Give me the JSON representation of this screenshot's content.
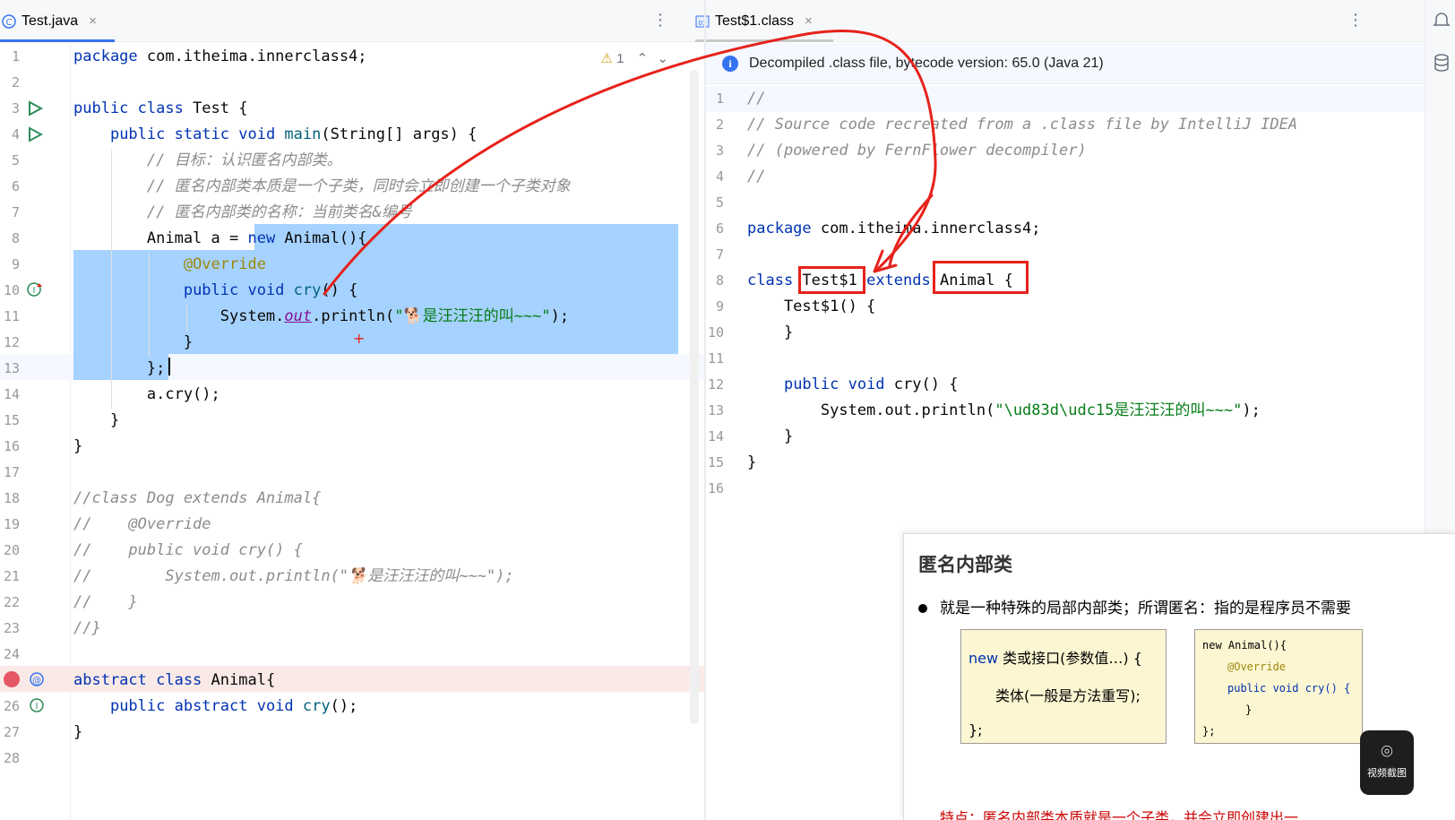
{
  "tabs": {
    "left": {
      "label": "Test.java",
      "close": "×",
      "icon": "java-class-icon"
    },
    "right": {
      "label": "Test$1.class",
      "close": "×",
      "icon": "class-file-icon"
    },
    "menu": "⋮"
  },
  "left_editor": {
    "inspection": {
      "warning": "⚠",
      "count": "1",
      "up": "⌃",
      "down": "⌄"
    },
    "lines": [
      {
        "n": "1",
        "segs": [
          [
            "kw",
            "package "
          ],
          [
            "",
            "com.itheima.innerclass4;"
          ]
        ]
      },
      {
        "n": "2",
        "segs": []
      },
      {
        "n": "3",
        "segs": [
          [
            "kw",
            "public class "
          ],
          [
            "",
            "Test {"
          ]
        ]
      },
      {
        "n": "4",
        "segs": [
          [
            "",
            "    "
          ],
          [
            "kw",
            "public static void "
          ],
          [
            "fn",
            "main"
          ],
          [
            "",
            "(String[] args) {"
          ]
        ]
      },
      {
        "n": "5",
        "segs": [
          [
            "",
            "        "
          ],
          [
            "cm",
            "// 目标：认识匿名内部类。"
          ]
        ]
      },
      {
        "n": "6",
        "segs": [
          [
            "",
            "        "
          ],
          [
            "cm",
            "// 匿名内部类本质是一个子类，同时会立即创建一个子类对象"
          ]
        ]
      },
      {
        "n": "7",
        "segs": [
          [
            "",
            "        "
          ],
          [
            "cm",
            "// 匿名内部类的名称：当前类名&编号"
          ]
        ]
      },
      {
        "n": "8",
        "segs": [
          [
            "",
            "        Animal a = "
          ],
          [
            "kw",
            "new "
          ],
          [
            "",
            "Animal(){"
          ]
        ]
      },
      {
        "n": "9",
        "segs": [
          [
            "",
            "            "
          ],
          [
            "an",
            "@Override"
          ]
        ]
      },
      {
        "n": "10",
        "segs": [
          [
            "",
            "            "
          ],
          [
            "kw",
            "public void "
          ],
          [
            "fn",
            "cry"
          ],
          [
            "",
            "() {"
          ]
        ]
      },
      {
        "n": "11",
        "segs": [
          [
            "",
            "                System."
          ],
          [
            "fld",
            "out"
          ],
          [
            "",
            ".println("
          ],
          [
            "st",
            "\"🐕是汪汪汪的叫~~~\""
          ],
          [
            "",
            ");"
          ]
        ]
      },
      {
        "n": "12",
        "segs": [
          [
            "",
            "            }"
          ]
        ]
      },
      {
        "n": "13",
        "segs": [
          [
            "",
            "        };"
          ]
        ]
      },
      {
        "n": "14",
        "segs": [
          [
            "",
            "        a.cry();"
          ]
        ]
      },
      {
        "n": "15",
        "segs": [
          [
            "",
            "    }"
          ]
        ]
      },
      {
        "n": "16",
        "segs": [
          [
            "",
            "}"
          ]
        ]
      },
      {
        "n": "17",
        "segs": []
      },
      {
        "n": "18",
        "segs": [
          [
            "cm",
            "//class Dog extends Animal{"
          ]
        ]
      },
      {
        "n": "19",
        "segs": [
          [
            "cm",
            "//    @Override"
          ]
        ]
      },
      {
        "n": "20",
        "segs": [
          [
            "cm",
            "//    public void cry() {"
          ]
        ]
      },
      {
        "n": "21",
        "segs": [
          [
            "cm",
            "//        System.out.println(\"🐕是汪汪汪的叫~~~\");"
          ]
        ]
      },
      {
        "n": "22",
        "segs": [
          [
            "cm",
            "//    }"
          ]
        ]
      },
      {
        "n": "23",
        "segs": [
          [
            "cm",
            "//}"
          ]
        ]
      },
      {
        "n": "24",
        "segs": []
      },
      {
        "n": "25",
        "segs": [
          [
            "kw",
            "abstract class "
          ],
          [
            "",
            "Animal{"
          ]
        ]
      },
      {
        "n": "26",
        "segs": [
          [
            "",
            "    "
          ],
          [
            "kw",
            "public abstract void "
          ],
          [
            "fn",
            "cry"
          ],
          [
            "",
            "();"
          ]
        ]
      },
      {
        "n": "27",
        "segs": [
          [
            "",
            "}"
          ]
        ]
      },
      {
        "n": "28",
        "segs": []
      }
    ]
  },
  "right_editor": {
    "banner": "Decompiled .class file, bytecode version: 65.0 (Java 21)",
    "info_icon_glyph": "i",
    "lines": [
      {
        "n": "1",
        "segs": [
          [
            "cm",
            "//"
          ]
        ]
      },
      {
        "n": "2",
        "segs": [
          [
            "cm",
            "// Source code recreated from a .class file by IntelliJ IDEA"
          ]
        ]
      },
      {
        "n": "3",
        "segs": [
          [
            "cm",
            "// (powered by FernFlower decompiler)"
          ]
        ]
      },
      {
        "n": "4",
        "segs": [
          [
            "cm",
            "//"
          ]
        ]
      },
      {
        "n": "5",
        "segs": []
      },
      {
        "n": "6",
        "segs": [
          [
            "kw",
            "package "
          ],
          [
            "",
            "com.itheima.innerclass4;"
          ]
        ]
      },
      {
        "n": "7",
        "segs": []
      },
      {
        "n": "8",
        "segs": [
          [
            "kw",
            "class "
          ],
          [
            "",
            "Test$1 "
          ],
          [
            "kw",
            "extends "
          ],
          [
            "",
            "Animal {"
          ]
        ]
      },
      {
        "n": "9",
        "segs": [
          [
            "",
            "    Test$1() {"
          ]
        ]
      },
      {
        "n": "10",
        "segs": [
          [
            "",
            "    }"
          ]
        ]
      },
      {
        "n": "11",
        "segs": []
      },
      {
        "n": "12",
        "segs": [
          [
            "",
            "    "
          ],
          [
            "kw",
            "public void "
          ],
          [
            "",
            "cry() {"
          ]
        ]
      },
      {
        "n": "13",
        "segs": [
          [
            "",
            "        System.out.println("
          ],
          [
            "st",
            "\"\\ud83d\\udc15是汪汪汪的叫~~~\""
          ],
          [
            "",
            ");"
          ]
        ]
      },
      {
        "n": "14",
        "segs": [
          [
            "",
            "    }"
          ]
        ]
      },
      {
        "n": "15",
        "segs": [
          [
            "",
            "}"
          ]
        ]
      },
      {
        "n": "16",
        "segs": []
      }
    ]
  },
  "slide": {
    "title": "匿名内部类",
    "bullet": "就是一种特殊的局部内部类；所谓匿名：指的是程序员不需要",
    "box1": [
      "new 类或接口(参数值…) {",
      "类体(一般是方法重写);",
      "};"
    ],
    "box1_kw": "new",
    "box2": [
      "new Animal(){",
      "@Override",
      "public void cry() {",
      "}",
      "};"
    ],
    "footer": "特点：匿名内部类本质就是一个子类，并会立即创建出一"
  },
  "camera": {
    "glyph": "⌾",
    "label": "视频截图"
  },
  "colors": {
    "keyword": "#0033b3",
    "comment": "#8c8c8c",
    "string": "#067d17",
    "selection": "#a6d2ff",
    "annotation_red": "#e6221b",
    "accent": "#3574f0"
  }
}
